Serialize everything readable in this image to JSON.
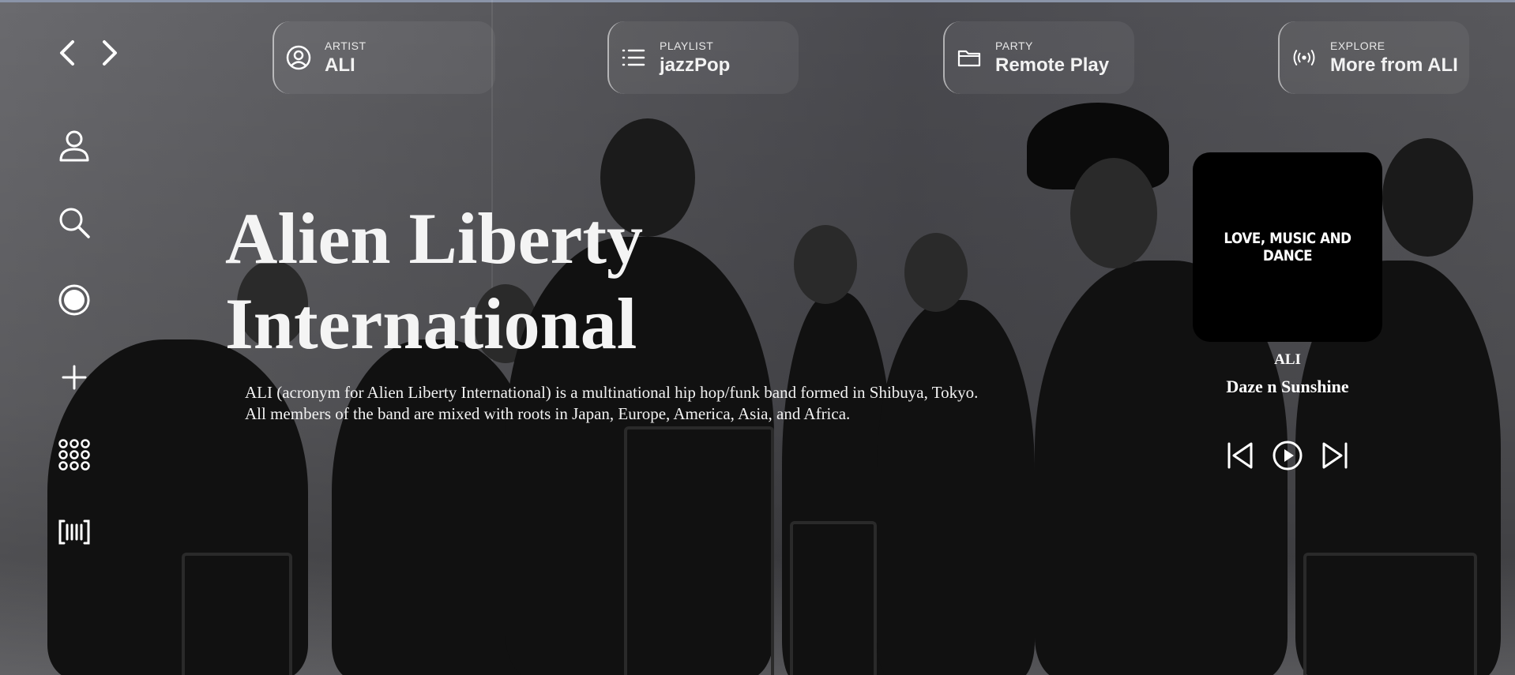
{
  "nav": {
    "back_icon": "chevron-left-icon",
    "forward_icon": "chevron-right-icon"
  },
  "sidebar": {
    "items": [
      {
        "icon": "user-icon"
      },
      {
        "icon": "search-icon"
      },
      {
        "icon": "record-icon"
      },
      {
        "icon": "plus-icon"
      },
      {
        "icon": "grid-dots-icon"
      },
      {
        "icon": "barcode-icon"
      }
    ]
  },
  "top_cards": [
    {
      "kicker": "ARTIST",
      "value": "ALI",
      "icon": "user-circle-icon"
    },
    {
      "kicker": "PLAYLIST",
      "value": "jazzPop",
      "icon": "list-icon"
    },
    {
      "kicker": "PARTY",
      "value": "Remote Play",
      "icon": "folder-icon"
    },
    {
      "kicker": "EXPLORE",
      "value": "More from ALI",
      "icon": "broadcast-icon"
    }
  ],
  "hero": {
    "title_line1": "Alien Liberty",
    "title_line2": "International",
    "description": "ALI (acronym for Alien Liberty International) is a multinational hip hop/funk band formed in Shibuya, Tokyo. All members of the band are mixed with roots in Japan, Europe, America, Asia, and Africa."
  },
  "player": {
    "cover_text": "LOVE, MUSIC AND DANCE",
    "artist": "ALI",
    "track": "Daze n Sunshine",
    "controls": [
      "skip-back-icon",
      "play-icon",
      "skip-forward-icon"
    ]
  },
  "colors": {
    "text": "#ffffff",
    "cover_bg": "#000000",
    "card_border": "#c8c8c8"
  }
}
